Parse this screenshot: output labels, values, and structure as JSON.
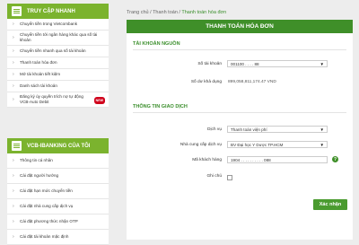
{
  "sidebar": {
    "quick_access": {
      "title": "TRUY CẬP NHANH",
      "items": [
        {
          "label": "Chuyển tiền trong Vietcombank"
        },
        {
          "label": "Chuyển tiền tới ngân hàng khác qua số tài khoản"
        },
        {
          "label": "Chuyển tiền nhanh qua số tài khoản"
        },
        {
          "label": "Thanh toán hóa đơn"
        },
        {
          "label": "Mở tài khoản tiết kiệm"
        },
        {
          "label": "Danh sách tài khoản"
        },
        {
          "label": "Đăng ký ủy quyền trích nợ tự động VCB-Auto Debit",
          "badge": "NEW"
        }
      ]
    },
    "my_bank": {
      "title": "VCB-IBANKING CỦA TÔI",
      "items": [
        {
          "label": "Thông tin cá nhân"
        },
        {
          "label": "Cài đặt người hưởng"
        },
        {
          "label": "Cài đặt hạn mức chuyển tiền"
        },
        {
          "label": "Cài đặt nhà cung cấp dịch vụ"
        },
        {
          "label": "Cài đặt phương thức nhận OTP"
        },
        {
          "label": "Cài đặt tài khoản mặc định"
        }
      ]
    }
  },
  "breadcrumb": {
    "home": "Trang chủ",
    "sep1": "/",
    "payment": "Thanh toán",
    "sep2": "/",
    "current": "Thanh toán hóa đơn"
  },
  "form": {
    "title": "THANH TOÁN HÓA ĐƠN",
    "source_section": "TÀI KHOẢN NGUỒN",
    "account_label": "Số tài khoản",
    "account_value": "001100 . . . . 88",
    "balance_label": "Số dư khả dụng",
    "balance_value": "899,058,811,174.47 VND",
    "transaction_section": "THÔNG TIN GIAO DỊCH",
    "service_label": "Dịch vụ",
    "service_value": "Thanh toán viện phí",
    "provider_label": "Nhà cung cấp dịch vụ",
    "provider_value": "BV Đại học Y Dược TP.HCM",
    "customer_code_label": "Mã khách hàng",
    "customer_code_value": "1904 . . . . . . . . . . 088",
    "note_label": "Ghi chú",
    "confirm_button": "Xác nhận"
  }
}
